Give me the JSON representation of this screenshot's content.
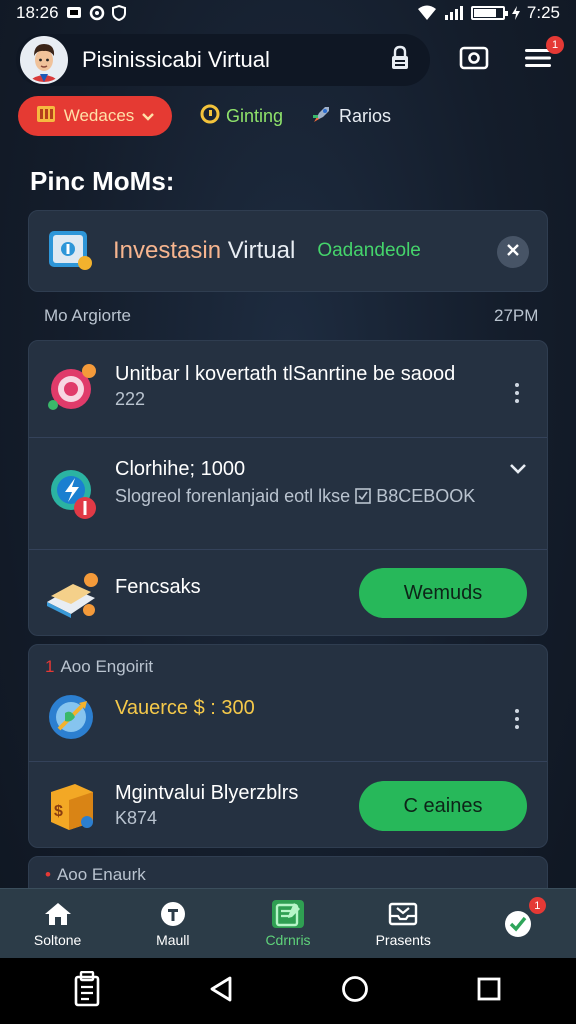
{
  "status_bar": {
    "time_left": "18:26",
    "time_right": "7:25"
  },
  "header": {
    "app_title": "Pisinissicabi Virtual",
    "notification_count": "1"
  },
  "chips": [
    {
      "label": "Wedaces",
      "icon": "grid-icon"
    },
    {
      "label": "Ginting",
      "icon": "coin-icon"
    },
    {
      "label": "Rarios",
      "icon": "rocket-icon"
    }
  ],
  "section_title": "Pinc MoMs:",
  "banner": {
    "title_part1": "Investasin",
    "title_part2": " Virtual",
    "link": "Oadandeole"
  },
  "meta": {
    "left": "Mo Argiorte",
    "right": "27PM"
  },
  "list1": [
    {
      "title": "Unitbar l kovertath tlSanrtine be saood",
      "subtitle": "222"
    },
    {
      "title": "Clorhihe; 1000",
      "subtitle": "Slogreol forenlanjaid eotl lkse",
      "code": "B8CEBOOK"
    },
    {
      "title": "Fencsaks",
      "button": "Wemuds"
    }
  ],
  "group2": {
    "marker": "1",
    "label": "Aoo Engoirit",
    "items": [
      {
        "title": "Vauerce $ : 300"
      },
      {
        "title": "Mgintvalui Blyerzblrs",
        "subtitle": "K874",
        "button": "C eaines"
      }
    ]
  },
  "group3": {
    "marker": "•",
    "label": "Aoo Enaurk"
  },
  "bottom_nav": [
    {
      "label": "Soltone",
      "icon": "home-icon"
    },
    {
      "label": "Maull",
      "icon": "shield-icon"
    },
    {
      "label": "Cdrnris",
      "icon": "clipboard-icon",
      "active": true
    },
    {
      "label": "Prasents",
      "icon": "inbox-icon"
    },
    {
      "label": "",
      "icon": "check-badge-icon",
      "badge": "1"
    }
  ],
  "colors": {
    "accent_green": "#27b85a",
    "chip_red": "#e53a33",
    "card_bg": "#253141",
    "badge_red": "#e53935"
  }
}
